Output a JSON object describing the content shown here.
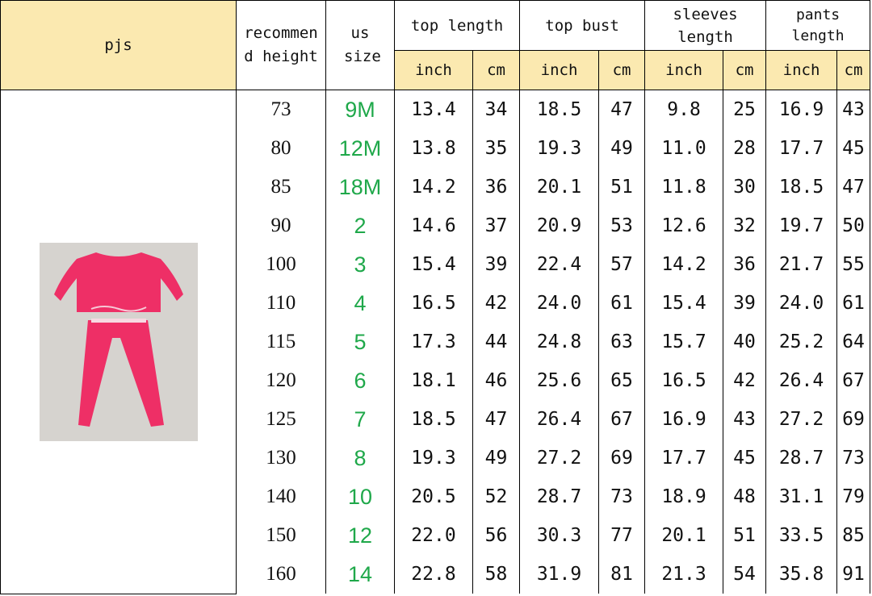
{
  "table": {
    "product_label": "pjs",
    "headers": {
      "height": "recommend height",
      "us_size": "us size",
      "top_length": "top length",
      "top_bust": "top bust",
      "sleeves_length": "sleeves length",
      "pants_length": "pants length",
      "unit_inch": "inch",
      "unit_cm": "cm"
    },
    "rows": [
      {
        "height": "73",
        "us": "9M",
        "tl_in": "13.4",
        "tl_cm": "34",
        "tb_in": "18.5",
        "tb_cm": "47",
        "sl_in": "9.8",
        "sl_cm": "25",
        "pl_in": "16.9",
        "pl_cm": "43"
      },
      {
        "height": "80",
        "us": "12M",
        "tl_in": "13.8",
        "tl_cm": "35",
        "tb_in": "19.3",
        "tb_cm": "49",
        "sl_in": "11.0",
        "sl_cm": "28",
        "pl_in": "17.7",
        "pl_cm": "45"
      },
      {
        "height": "85",
        "us": "18M",
        "tl_in": "14.2",
        "tl_cm": "36",
        "tb_in": "20.1",
        "tb_cm": "51",
        "sl_in": "11.8",
        "sl_cm": "30",
        "pl_in": "18.5",
        "pl_cm": "47"
      },
      {
        "height": "90",
        "us": "2",
        "tl_in": "14.6",
        "tl_cm": "37",
        "tb_in": "20.9",
        "tb_cm": "53",
        "sl_in": "12.6",
        "sl_cm": "32",
        "pl_in": "19.7",
        "pl_cm": "50"
      },
      {
        "height": "100",
        "us": "3",
        "tl_in": "15.4",
        "tl_cm": "39",
        "tb_in": "22.4",
        "tb_cm": "57",
        "sl_in": "14.2",
        "sl_cm": "36",
        "pl_in": "21.7",
        "pl_cm": "55"
      },
      {
        "height": "110",
        "us": "4",
        "tl_in": "16.5",
        "tl_cm": "42",
        "tb_in": "24.0",
        "tb_cm": "61",
        "sl_in": "15.4",
        "sl_cm": "39",
        "pl_in": "24.0",
        "pl_cm": "61"
      },
      {
        "height": "115",
        "us": "5",
        "tl_in": "17.3",
        "tl_cm": "44",
        "tb_in": "24.8",
        "tb_cm": "63",
        "sl_in": "15.7",
        "sl_cm": "40",
        "pl_in": "25.2",
        "pl_cm": "64"
      },
      {
        "height": "120",
        "us": "6",
        "tl_in": "18.1",
        "tl_cm": "46",
        "tb_in": "25.6",
        "tb_cm": "65",
        "sl_in": "16.5",
        "sl_cm": "42",
        "pl_in": "26.4",
        "pl_cm": "67"
      },
      {
        "height": "125",
        "us": "7",
        "tl_in": "18.5",
        "tl_cm": "47",
        "tb_in": "26.4",
        "tb_cm": "67",
        "sl_in": "16.9",
        "sl_cm": "43",
        "pl_in": "27.2",
        "pl_cm": "69"
      },
      {
        "height": "130",
        "us": "8",
        "tl_in": "19.3",
        "tl_cm": "49",
        "tb_in": "27.2",
        "tb_cm": "69",
        "sl_in": "17.7",
        "sl_cm": "45",
        "pl_in": "28.7",
        "pl_cm": "73"
      },
      {
        "height": "140",
        "us": "10",
        "tl_in": "20.5",
        "tl_cm": "52",
        "tb_in": "28.7",
        "tb_cm": "73",
        "sl_in": "18.9",
        "sl_cm": "48",
        "pl_in": "31.1",
        "pl_cm": "79"
      },
      {
        "height": "150",
        "us": "12",
        "tl_in": "22.0",
        "tl_cm": "56",
        "tb_in": "30.3",
        "tb_cm": "77",
        "sl_in": "20.1",
        "sl_cm": "51",
        "pl_in": "33.5",
        "pl_cm": "85"
      },
      {
        "height": "160",
        "us": "14",
        "tl_in": "22.8",
        "tl_cm": "58",
        "tb_in": "31.9",
        "tb_cm": "81",
        "sl_in": "21.3",
        "sl_cm": "54",
        "pl_in": "35.8",
        "pl_cm": "91"
      }
    ]
  },
  "photo": {
    "subject": "pink long-sleeve pajama set",
    "garment_color": "#ee2f66",
    "background_color": "#d6d3cf"
  },
  "colors": {
    "header_bg": "#fbe9b0",
    "us_size_text": "#1fa84a",
    "border": "#000000"
  }
}
